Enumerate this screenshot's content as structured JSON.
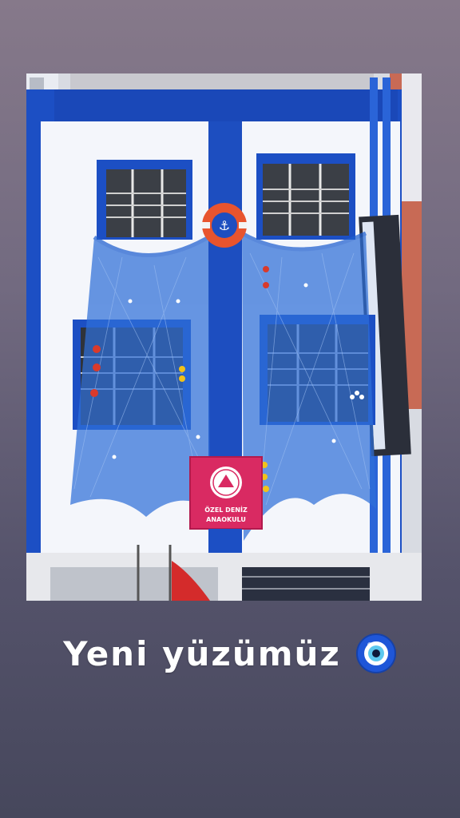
{
  "story": {
    "caption": "Yeni yüzümüz",
    "caption_emoji": "nazar-evil-eye-icon"
  },
  "photo": {
    "sign": {
      "line1": "ÖZEL DENİZ",
      "line2": "ANAOKULU"
    }
  },
  "colors": {
    "building_blue": "#1c4fc4",
    "building_white": "#f4f6fb",
    "net_blue": "#2f6fd8",
    "sign_pink": "#d92a62",
    "lifebuoy": "#e8542e"
  }
}
